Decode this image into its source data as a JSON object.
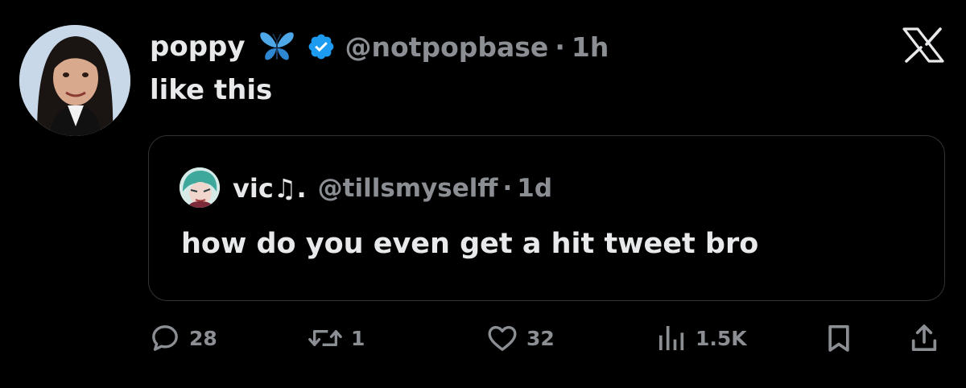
{
  "tweet": {
    "display_name": "poppy",
    "handle": "@notpopbase",
    "separator": "·",
    "time": "1h",
    "text": "like this"
  },
  "icons": {
    "butterfly": "butterfly-emoji-icon",
    "verified": "verified-badge-icon",
    "platform": "x-logo-icon"
  },
  "quote": {
    "display_name": "vic♫.",
    "handle": "@tillsmyselff",
    "separator": "·",
    "time": "1d",
    "text": "how do you even get a hit tweet bro"
  },
  "actions": {
    "replies": "28",
    "retweets": "1",
    "likes": "32",
    "views": "1.5K"
  },
  "colors": {
    "background": "#000000",
    "primary_text": "#e7e9ea",
    "secondary_text": "#8b8f94",
    "border": "#2f3336",
    "verified_blue": "#1d9bf0",
    "butterfly_blue": "#4ea8e8"
  }
}
